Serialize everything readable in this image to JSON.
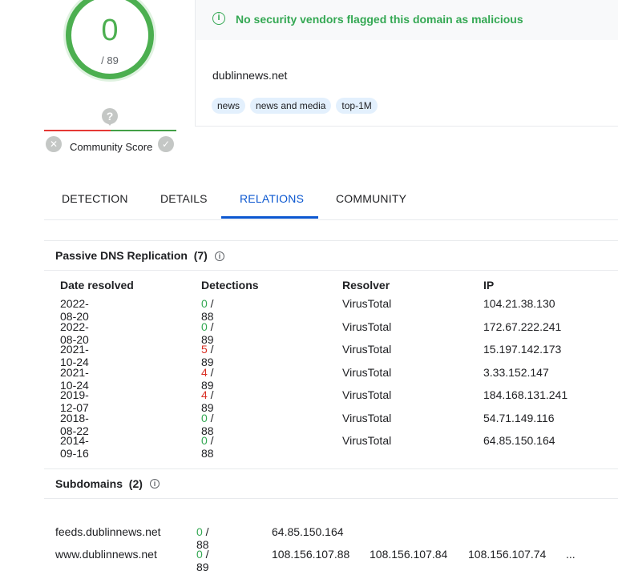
{
  "score": {
    "detections": "0",
    "total": "/ 89"
  },
  "community": {
    "label": "Community Score",
    "question": "?",
    "down_icon": "✕",
    "up_icon": "✓"
  },
  "banner": {
    "icon": "i",
    "message": "No security vendors flagged this domain as malicious"
  },
  "domain": "dublinnews.net",
  "tags": [
    "news",
    "news and media",
    "top-1M"
  ],
  "tabs": [
    {
      "label": "DETECTION"
    },
    {
      "label": "DETAILS"
    },
    {
      "label": "RELATIONS"
    },
    {
      "label": "COMMUNITY"
    }
  ],
  "active_tab": "RELATIONS",
  "passive_dns": {
    "title": "Passive DNS Replication",
    "count": "(7)",
    "columns": [
      "Date resolved",
      "Detections",
      "Resolver",
      "IP"
    ],
    "rows": [
      {
        "date": "2022-08-20",
        "det": "0",
        "total": " / 88",
        "resolver": "VirusTotal",
        "ip": "104.21.38.130"
      },
      {
        "date": "2022-08-20",
        "det": "0",
        "total": " / 89",
        "resolver": "VirusTotal",
        "ip": "172.67.222.241"
      },
      {
        "date": "2021-10-24",
        "det": "5",
        "total": " / 89",
        "resolver": "VirusTotal",
        "ip": "15.197.142.173"
      },
      {
        "date": "2021-10-24",
        "det": "4",
        "total": " / 89",
        "resolver": "VirusTotal",
        "ip": "3.33.152.147"
      },
      {
        "date": "2019-12-07",
        "det": "4",
        "total": " / 89",
        "resolver": "VirusTotal",
        "ip": "184.168.131.241"
      },
      {
        "date": "2018-08-22",
        "det": "0",
        "total": " / 88",
        "resolver": "VirusTotal",
        "ip": "54.71.149.116"
      },
      {
        "date": "2014-09-16",
        "det": "0",
        "total": " / 88",
        "resolver": "VirusTotal",
        "ip": "64.85.150.164"
      }
    ]
  },
  "subdomains": {
    "title": "Subdomains",
    "count": "(2)",
    "rows": [
      {
        "name": "feeds.dublinnews.net",
        "det": "0",
        "total": " / 88",
        "ips": [
          "64.85.150.164"
        ],
        "more": ""
      },
      {
        "name": "www.dublinnews.net",
        "det": "0",
        "total": " / 89",
        "ips": [
          "108.156.107.88",
          "108.156.107.84",
          "108.156.107.74"
        ],
        "more": "..."
      }
    ]
  },
  "colors": {
    "good": "#34a853",
    "bad": "#d93025",
    "accent": "#0b57d0"
  }
}
